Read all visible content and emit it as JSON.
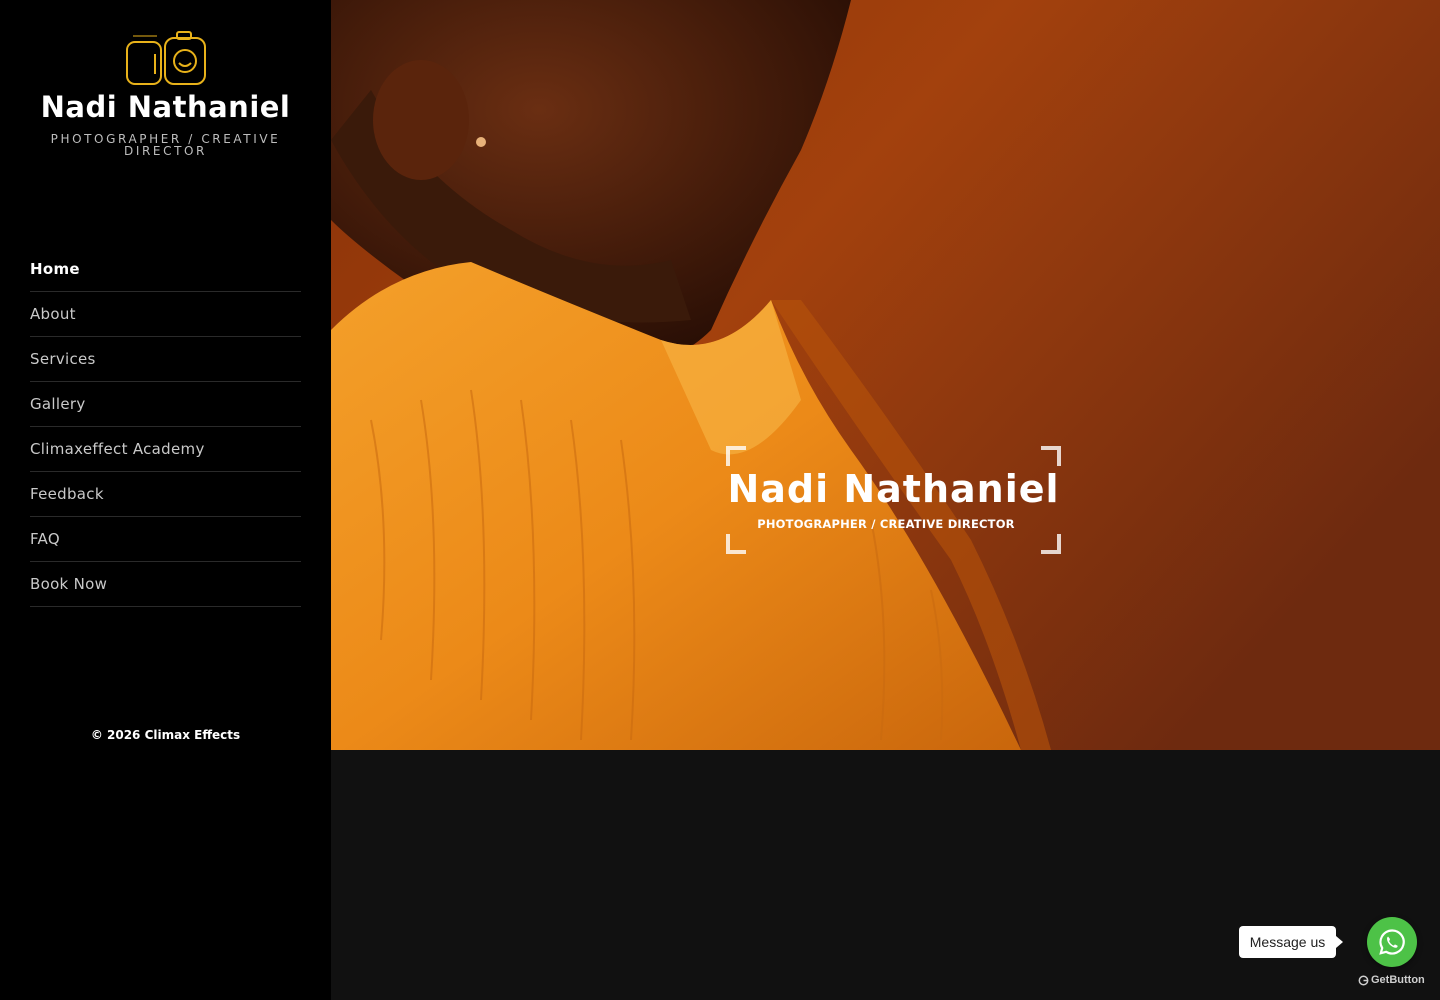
{
  "sidebar": {
    "logo": {
      "icon": "camera-logo-icon",
      "name": "Nadi Nathaniel",
      "tagline": "PHOTOGRAPHER / CREATIVE DIRECTOR"
    },
    "nav": [
      {
        "label": "Home",
        "active": true
      },
      {
        "label": "About",
        "active": false
      },
      {
        "label": "Services",
        "active": false
      },
      {
        "label": "Gallery",
        "active": false
      },
      {
        "label": "Climaxeffect Academy",
        "active": false
      },
      {
        "label": "Feedback",
        "active": false
      },
      {
        "label": "FAQ",
        "active": false
      },
      {
        "label": "Book Now",
        "active": false
      }
    ],
    "copyright": "© 2026 Climax Effects"
  },
  "hero": {
    "title": "Nadi Nathaniel",
    "subtitle": "PHOTOGRAPHER / CREATIVE DIRECTOR"
  },
  "chat_widget": {
    "message_label": "Message us",
    "button_icon": "whatsapp-icon",
    "branding": "GetButton",
    "accent_color": "#4dc247"
  },
  "colors": {
    "logo_accent": "#e8b21a",
    "hero_background": "#7a2a0c"
  }
}
